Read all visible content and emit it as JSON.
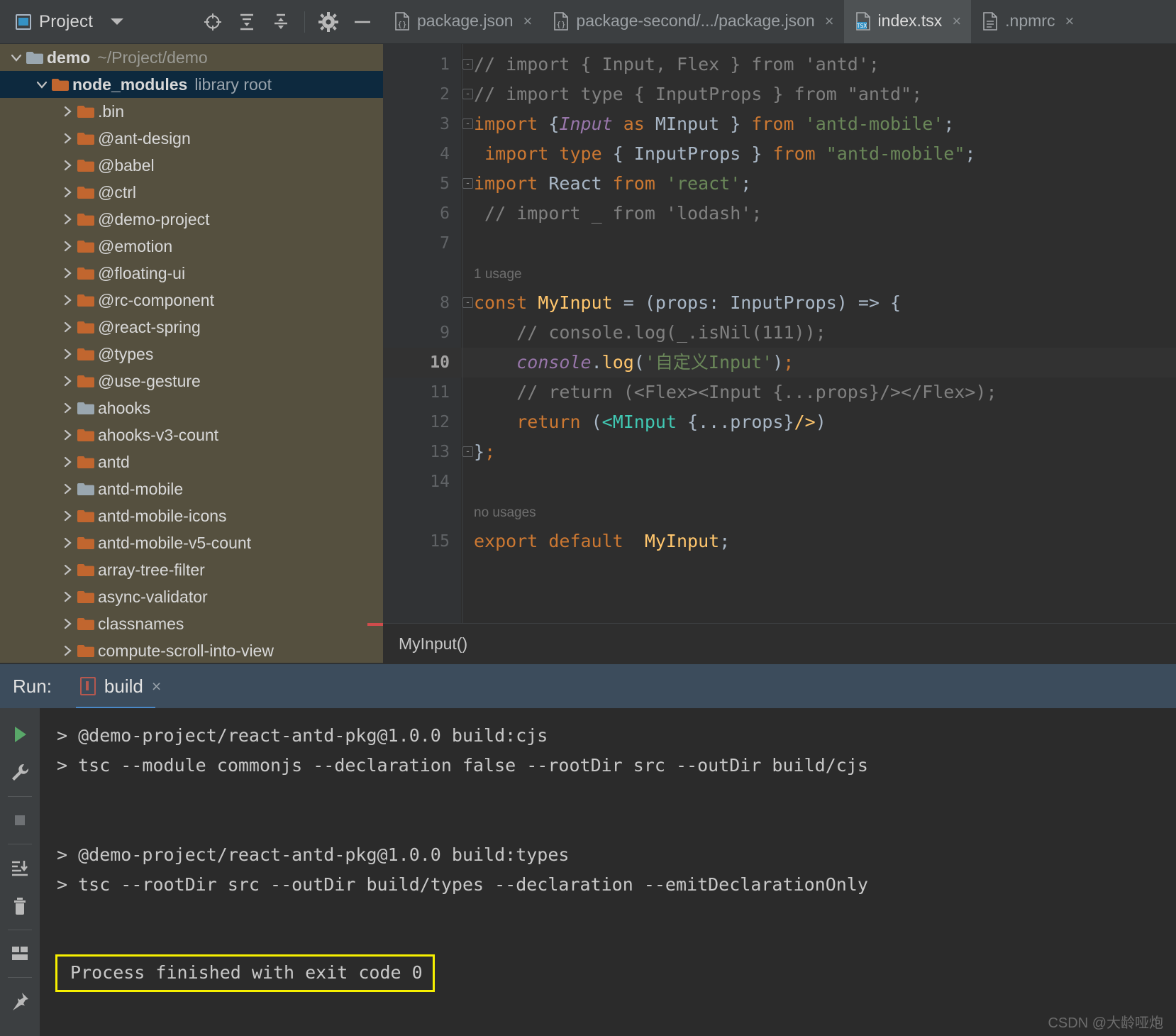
{
  "project_panel": {
    "title": "Project",
    "icons": [
      {
        "name": "locate-icon",
        "glyph": "target"
      },
      {
        "name": "expand-all-icon",
        "glyph": "expand"
      },
      {
        "name": "collapse-all-icon",
        "glyph": "collapse"
      },
      {
        "name": "settings-gear-icon",
        "glyph": "gear"
      },
      {
        "name": "hide-panel-icon",
        "glyph": "minus"
      }
    ]
  },
  "tabs": [
    {
      "label": "package.json",
      "icon": "json-file-icon",
      "active": false,
      "close": "×"
    },
    {
      "label": "package-second/.../package.json",
      "icon": "json-file-icon",
      "active": false,
      "close": "×"
    },
    {
      "label": "index.tsx",
      "icon": "tsx-file-icon",
      "active": true,
      "close": "×"
    },
    {
      "label": ".npmrc",
      "icon": "config-file-icon",
      "active": false,
      "close": "×"
    }
  ],
  "tree": [
    {
      "label": "demo",
      "sub": "~/Project/demo",
      "indent": 0,
      "expanded": true,
      "folder": "plain",
      "bold": true,
      "selected": false,
      "squiggle": true
    },
    {
      "label": "node_modules",
      "sub": "library root",
      "indent": 1,
      "expanded": true,
      "folder": "orange",
      "bold": true,
      "selected": true
    },
    {
      "label": ".bin",
      "sub": "",
      "indent": 2,
      "expanded": false,
      "folder": "orange",
      "bold": false,
      "selected": false
    },
    {
      "label": "@ant-design",
      "sub": "",
      "indent": 2,
      "expanded": false,
      "folder": "orange",
      "bold": false,
      "selected": false
    },
    {
      "label": "@babel",
      "sub": "",
      "indent": 2,
      "expanded": false,
      "folder": "orange",
      "bold": false,
      "selected": false
    },
    {
      "label": "@ctrl",
      "sub": "",
      "indent": 2,
      "expanded": false,
      "folder": "orange",
      "bold": false,
      "selected": false
    },
    {
      "label": "@demo-project",
      "sub": "",
      "indent": 2,
      "expanded": false,
      "folder": "orange",
      "bold": false,
      "selected": false
    },
    {
      "label": "@emotion",
      "sub": "",
      "indent": 2,
      "expanded": false,
      "folder": "orange",
      "bold": false,
      "selected": false
    },
    {
      "label": "@floating-ui",
      "sub": "",
      "indent": 2,
      "expanded": false,
      "folder": "orange",
      "bold": false,
      "selected": false
    },
    {
      "label": "@rc-component",
      "sub": "",
      "indent": 2,
      "expanded": false,
      "folder": "orange",
      "bold": false,
      "selected": false
    },
    {
      "label": "@react-spring",
      "sub": "",
      "indent": 2,
      "expanded": false,
      "folder": "orange",
      "bold": false,
      "selected": false
    },
    {
      "label": "@types",
      "sub": "",
      "indent": 2,
      "expanded": false,
      "folder": "orange",
      "bold": false,
      "selected": false
    },
    {
      "label": "@use-gesture",
      "sub": "",
      "indent": 2,
      "expanded": false,
      "folder": "orange",
      "bold": false,
      "selected": false
    },
    {
      "label": "ahooks",
      "sub": "",
      "indent": 2,
      "expanded": false,
      "folder": "gray",
      "bold": false,
      "selected": false
    },
    {
      "label": "ahooks-v3-count",
      "sub": "",
      "indent": 2,
      "expanded": false,
      "folder": "orange",
      "bold": false,
      "selected": false
    },
    {
      "label": "antd",
      "sub": "",
      "indent": 2,
      "expanded": false,
      "folder": "orange",
      "bold": false,
      "selected": false
    },
    {
      "label": "antd-mobile",
      "sub": "",
      "indent": 2,
      "expanded": false,
      "folder": "gray",
      "bold": false,
      "selected": false
    },
    {
      "label": "antd-mobile-icons",
      "sub": "",
      "indent": 2,
      "expanded": false,
      "folder": "orange",
      "bold": false,
      "selected": false
    },
    {
      "label": "antd-mobile-v5-count",
      "sub": "",
      "indent": 2,
      "expanded": false,
      "folder": "orange",
      "bold": false,
      "selected": false
    },
    {
      "label": "array-tree-filter",
      "sub": "",
      "indent": 2,
      "expanded": false,
      "folder": "orange",
      "bold": false,
      "selected": false
    },
    {
      "label": "async-validator",
      "sub": "",
      "indent": 2,
      "expanded": false,
      "folder": "orange",
      "bold": false,
      "selected": false
    },
    {
      "label": "classnames",
      "sub": "",
      "indent": 2,
      "expanded": false,
      "folder": "orange",
      "bold": false,
      "selected": false
    },
    {
      "label": "compute-scroll-into-view",
      "sub": "",
      "indent": 2,
      "expanded": false,
      "folder": "orange",
      "bold": false,
      "selected": false
    }
  ],
  "editor": {
    "lines": [
      {
        "num": "1",
        "fold": "minus",
        "current": false,
        "tokens": [
          {
            "t": "// import { Input, Flex } from 'antd';",
            "c": "cm"
          }
        ]
      },
      {
        "num": "2",
        "fold": "minus",
        "current": false,
        "tokens": [
          {
            "t": "// import type { InputProps } from \"antd\";",
            "c": "cm"
          }
        ]
      },
      {
        "num": "3",
        "fold": "minus",
        "current": false,
        "tokens": [
          {
            "t": "import ",
            "c": "kw"
          },
          {
            "t": "{",
            "c": "br"
          },
          {
            "t": "Input",
            "c": "it"
          },
          {
            "t": " as ",
            "c": "kw"
          },
          {
            "t": "MInput ",
            "c": "tp"
          },
          {
            "t": "} ",
            "c": "br"
          },
          {
            "t": "from ",
            "c": "kw"
          },
          {
            "t": "'antd-mobile'",
            "c": "st"
          },
          {
            "t": ";",
            "c": "br"
          }
        ]
      },
      {
        "num": "4",
        "fold": "",
        "current": false,
        "tokens": [
          {
            "t": " ",
            "c": "tp"
          },
          {
            "t": "import type ",
            "c": "kw"
          },
          {
            "t": "{ InputProps } ",
            "c": "tp"
          },
          {
            "t": "from ",
            "c": "kw"
          },
          {
            "t": "\"antd-mobile\"",
            "c": "st"
          },
          {
            "t": ";",
            "c": "br"
          }
        ]
      },
      {
        "num": "5",
        "fold": "minus",
        "current": false,
        "tokens": [
          {
            "t": "import ",
            "c": "kw"
          },
          {
            "t": "React ",
            "c": "tp"
          },
          {
            "t": "from ",
            "c": "kw"
          },
          {
            "t": "'react'",
            "c": "st"
          },
          {
            "t": ";",
            "c": "br"
          }
        ]
      },
      {
        "num": "6",
        "fold": "",
        "current": false,
        "tokens": [
          {
            "t": " // import _ from 'lodash';",
            "c": "cm"
          }
        ]
      },
      {
        "num": "7",
        "fold": "",
        "current": false,
        "tokens": []
      },
      {
        "num": "",
        "fold": "",
        "current": false,
        "hint": "1 usage",
        "tokens": []
      },
      {
        "num": "8",
        "fold": "minus",
        "current": false,
        "tokens": [
          {
            "t": "const ",
            "c": "kw"
          },
          {
            "t": "MyInput ",
            "c": "fn"
          },
          {
            "t": "= (props: InputProps) => {",
            "c": "tp"
          }
        ]
      },
      {
        "num": "9",
        "fold": "",
        "current": false,
        "tokens": [
          {
            "t": "    // console.log(_.isNil(111));",
            "c": "cm"
          }
        ]
      },
      {
        "num": "10",
        "fold": "",
        "current": true,
        "tokens": [
          {
            "t": "    ",
            "c": "tp"
          },
          {
            "t": "console",
            "c": "it"
          },
          {
            "t": ".",
            "c": "tp"
          },
          {
            "t": "log",
            "c": "fn"
          },
          {
            "t": "(",
            "c": "tp"
          },
          {
            "t": "'自定义Input'",
            "c": "st"
          },
          {
            "t": ")",
            "c": "tp"
          },
          {
            "t": ";",
            "c": "kw"
          }
        ]
      },
      {
        "num": "11",
        "fold": "",
        "current": false,
        "tokens": [
          {
            "t": "    // return (<Flex><Input {...props}/></Flex>);",
            "c": "cm"
          }
        ]
      },
      {
        "num": "12",
        "fold": "",
        "current": false,
        "tokens": [
          {
            "t": "    ",
            "c": "tp"
          },
          {
            "t": "return ",
            "c": "kw"
          },
          {
            "t": "(",
            "c": "tp"
          },
          {
            "t": "<MInput ",
            "c": "tag"
          },
          {
            "t": "{...props}",
            "c": "tp"
          },
          {
            "t": "/>",
            "c": "fn"
          },
          {
            "t": ")",
            "c": "tp"
          }
        ]
      },
      {
        "num": "13",
        "fold": "minus",
        "current": false,
        "tokens": [
          {
            "t": "}",
            "c": "tp"
          },
          {
            "t": ";",
            "c": "kw"
          }
        ]
      },
      {
        "num": "14",
        "fold": "",
        "current": false,
        "tokens": []
      },
      {
        "num": "",
        "fold": "",
        "current": false,
        "hint": "no usages",
        "tokens": []
      },
      {
        "num": "15",
        "fold": "",
        "current": false,
        "tokens": [
          {
            "t": "export default ",
            "c": "kw"
          },
          {
            "t": " MyInput",
            "c": "fn"
          },
          {
            "t": ";",
            "c": "br"
          }
        ]
      }
    ],
    "breadcrumb": "MyInput()"
  },
  "run_panel": {
    "label": "Run:",
    "tab_name": "build",
    "tab_close": "×",
    "side_icons": [
      {
        "name": "rerun-run-icon",
        "glyph": "play"
      },
      {
        "name": "rerun-settings-wrench-icon",
        "glyph": "wrench"
      },
      {
        "name": "stop-process-icon",
        "glyph": "square"
      },
      {
        "name": "scroll-to-end-icon",
        "glyph": "scroll-end"
      },
      {
        "name": "clear-all-icon",
        "glyph": "trash"
      },
      {
        "name": "layout-settings-icon",
        "glyph": "layout"
      },
      {
        "name": "pin-tab-icon",
        "glyph": "pin"
      }
    ],
    "console_lines": [
      "> @demo-project/react-antd-pkg@1.0.0 build:cjs",
      "> tsc --module commonjs --declaration false --rootDir src --outDir build/cjs",
      "",
      "",
      "> @demo-project/react-antd-pkg@1.0.0 build:types",
      "> tsc --rootDir src --outDir build/types --declaration --emitDeclarationOnly",
      "",
      ""
    ],
    "finished_message": "Process finished with exit code 0",
    "highlight_color": "#f7f000"
  },
  "watermark": "CSDN @大龄哑炮"
}
